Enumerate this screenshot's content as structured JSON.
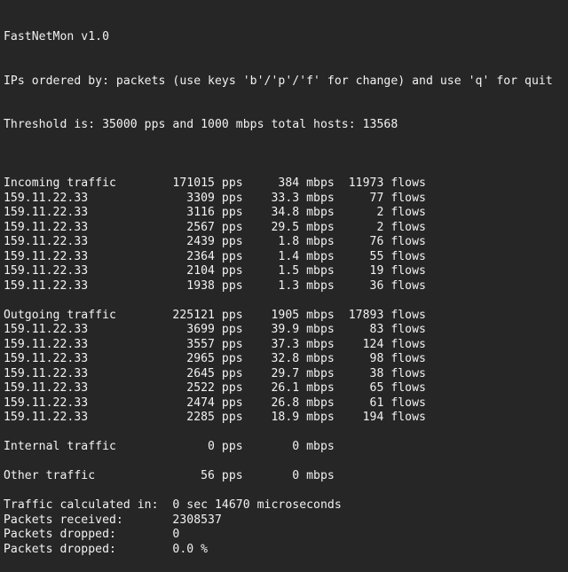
{
  "header": {
    "title": "FastNetMon v1.0",
    "order_line": "IPs ordered by: packets (use keys 'b'/'p'/'f' for change) and use 'q' for quit",
    "threshold_line": "Threshold is: 35000 pps and 1000 mbps total hosts: 13568"
  },
  "sections": [
    {
      "id": "incoming",
      "label": "Incoming traffic",
      "pps": "171015",
      "mbps": "384",
      "flows": "11973",
      "rows": [
        {
          "ip": "159.11.22.33",
          "pps": "3309",
          "mbps": "33.3",
          "flows": "77"
        },
        {
          "ip": "159.11.22.33",
          "pps": "3116",
          "mbps": "34.8",
          "flows": "2"
        },
        {
          "ip": "159.11.22.33",
          "pps": "2567",
          "mbps": "29.5",
          "flows": "2"
        },
        {
          "ip": "159.11.22.33",
          "pps": "2439",
          "mbps": "1.8",
          "flows": "76"
        },
        {
          "ip": "159.11.22.33",
          "pps": "2364",
          "mbps": "1.4",
          "flows": "55"
        },
        {
          "ip": "159.11.22.33",
          "pps": "2104",
          "mbps": "1.5",
          "flows": "19"
        },
        {
          "ip": "159.11.22.33",
          "pps": "1938",
          "mbps": "1.3",
          "flows": "36"
        }
      ]
    },
    {
      "id": "outgoing",
      "label": "Outgoing traffic",
      "pps": "225121",
      "mbps": "1905",
      "flows": "17893",
      "rows": [
        {
          "ip": "159.11.22.33",
          "pps": "3699",
          "mbps": "39.9",
          "flows": "83"
        },
        {
          "ip": "159.11.22.33",
          "pps": "3557",
          "mbps": "37.3",
          "flows": "124"
        },
        {
          "ip": "159.11.22.33",
          "pps": "2965",
          "mbps": "32.8",
          "flows": "98"
        },
        {
          "ip": "159.11.22.33",
          "pps": "2645",
          "mbps": "29.7",
          "flows": "38"
        },
        {
          "ip": "159.11.22.33",
          "pps": "2522",
          "mbps": "26.1",
          "flows": "65"
        },
        {
          "ip": "159.11.22.33",
          "pps": "2474",
          "mbps": "26.8",
          "flows": "61"
        },
        {
          "ip": "159.11.22.33",
          "pps": "2285",
          "mbps": "18.9",
          "flows": "194"
        }
      ]
    },
    {
      "id": "internal",
      "label": "Internal traffic",
      "pps": "0",
      "mbps": "0",
      "rows": []
    },
    {
      "id": "other",
      "label": "Other traffic",
      "pps": "56",
      "mbps": "0",
      "rows": []
    }
  ],
  "units": {
    "pps": "pps",
    "mbps": "mbps",
    "flows": "flows"
  },
  "stats": [
    {
      "label": "Traffic calculated in:",
      "value": "0 sec 14670 microseconds"
    },
    {
      "label": "Packets received:",
      "value": "2308537"
    },
    {
      "label": "Packets dropped:",
      "value": "0"
    },
    {
      "label": "Packets dropped:",
      "value": "0.0 %"
    }
  ]
}
